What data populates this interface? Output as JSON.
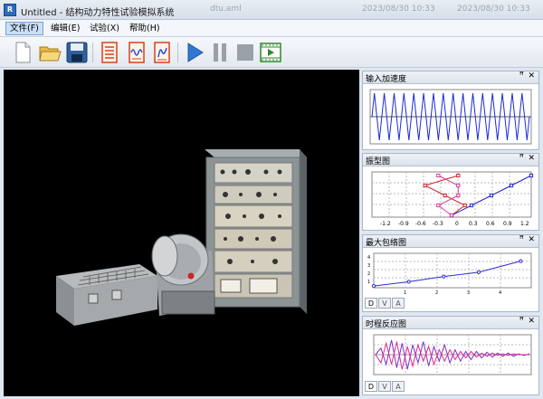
{
  "window": {
    "title": "Untitled - 结构动力特性试验模拟系统",
    "app_icon": "R",
    "background_tabs": [
      "dtu.aml",
      "2023/08/30 10:33",
      "2023/08/30 10:33"
    ]
  },
  "menu": [
    {
      "label": "文件(F)",
      "active": true
    },
    {
      "label": "编辑(E)",
      "active": false
    },
    {
      "label": "试验(X)",
      "active": false
    },
    {
      "label": "帮助(H)",
      "active": false
    }
  ],
  "toolbar": [
    "new-file-icon",
    "open-folder-icon",
    "save-icon",
    "sensor-setup-icon",
    "signal-generator-icon",
    "analysis-icon",
    "play-icon",
    "pause-icon",
    "stop-icon",
    "record-video-icon"
  ],
  "panels": {
    "input_acceleration": {
      "title": "输入加速度"
    },
    "mode_shape": {
      "title": "振型图",
      "x_ticks": [
        "-1.2",
        "-0.9",
        "-0.6",
        "-0.3",
        "0",
        "0.3",
        "0.6",
        "0.9",
        "1.2"
      ]
    },
    "max_envelope": {
      "title": "最大包络图",
      "x_ticks": [
        "1",
        "2",
        "3",
        "4"
      ],
      "y_ticks": [
        "4",
        "3",
        "2",
        "1"
      ]
    },
    "time_history": {
      "title": "时程反应图"
    }
  },
  "pin_glyph": "ꟸ",
  "tabs": [
    "D",
    "V",
    "A"
  ],
  "chart_data": [
    {
      "type": "line",
      "series": [
        {
          "values": [
            0,
            1,
            0,
            -1,
            0,
            1,
            0,
            -1,
            0,
            1,
            0,
            -1,
            0,
            1,
            0,
            -1,
            0,
            1,
            0,
            -1,
            0,
            1,
            0,
            -1,
            0,
            1,
            0,
            -1,
            0,
            1,
            0,
            -1,
            0,
            1,
            0,
            -1,
            0,
            1,
            0,
            -1,
            0,
            1,
            0,
            -1,
            0,
            1,
            0,
            -1,
            0,
            1,
            0,
            -1,
            0,
            1,
            0,
            -1,
            0,
            1,
            0,
            -1,
            0,
            1,
            0,
            -1,
            0
          ]
        }
      ]
    },
    {
      "type": "line",
      "x_ticks": [
        -1.2,
        -0.9,
        -0.6,
        -0.3,
        0,
        0.3,
        0.6,
        0.9,
        1.2
      ],
      "series": [
        {
          "color": "#2222cc",
          "x": [
            0,
            0.3,
            0.6,
            0.9,
            1.2
          ],
          "y": [
            0,
            1,
            2,
            3,
            4
          ]
        },
        {
          "color": "#d4202a",
          "x": [
            0,
            0.2,
            -0.1,
            -0.4,
            0.1
          ],
          "y": [
            0,
            1,
            2,
            3,
            4
          ]
        },
        {
          "color": "#d63c9a",
          "x": [
            0,
            -0.2,
            0.1,
            0.1,
            -0.2
          ],
          "y": [
            0,
            1,
            2,
            3,
            4
          ]
        }
      ]
    },
    {
      "type": "line",
      "xlim": [
        0,
        4.5
      ],
      "ylim": [
        0,
        4
      ],
      "series": [
        {
          "color": "#2b2bd6",
          "x": [
            0,
            1,
            2,
            3,
            4.2
          ],
          "y": [
            0.2,
            0.7,
            1.3,
            1.8,
            3.1
          ]
        }
      ]
    },
    {
      "type": "line",
      "series": [
        {
          "color": "#7a2fd0",
          "values": [
            0,
            0.4,
            -0.6,
            0.9,
            -0.8,
            0.7,
            -0.9,
            0.6,
            -0.5,
            0.8,
            -0.7,
            0.5,
            -0.4,
            0.6,
            -0.5,
            0.3,
            -0.4,
            0.2,
            -0.3,
            0.2,
            -0.2,
            0.15,
            -0.15,
            0.1,
            -0.1,
            0.1,
            -0.1,
            0.05,
            -0.05,
            0.05
          ]
        },
        {
          "color": "#e02a8a",
          "values": [
            0,
            -0.5,
            0.7,
            -0.6,
            0.8,
            -0.9,
            0.5,
            -0.7,
            0.6,
            -0.4,
            0.5,
            -0.6,
            0.3,
            -0.4,
            0.3,
            -0.3,
            0.2,
            -0.2,
            0.2,
            -0.15,
            0.1,
            -0.1,
            0.1,
            -0.05,
            0.05,
            -0.05,
            0.05,
            0,
            0,
            0
          ]
        }
      ]
    }
  ]
}
